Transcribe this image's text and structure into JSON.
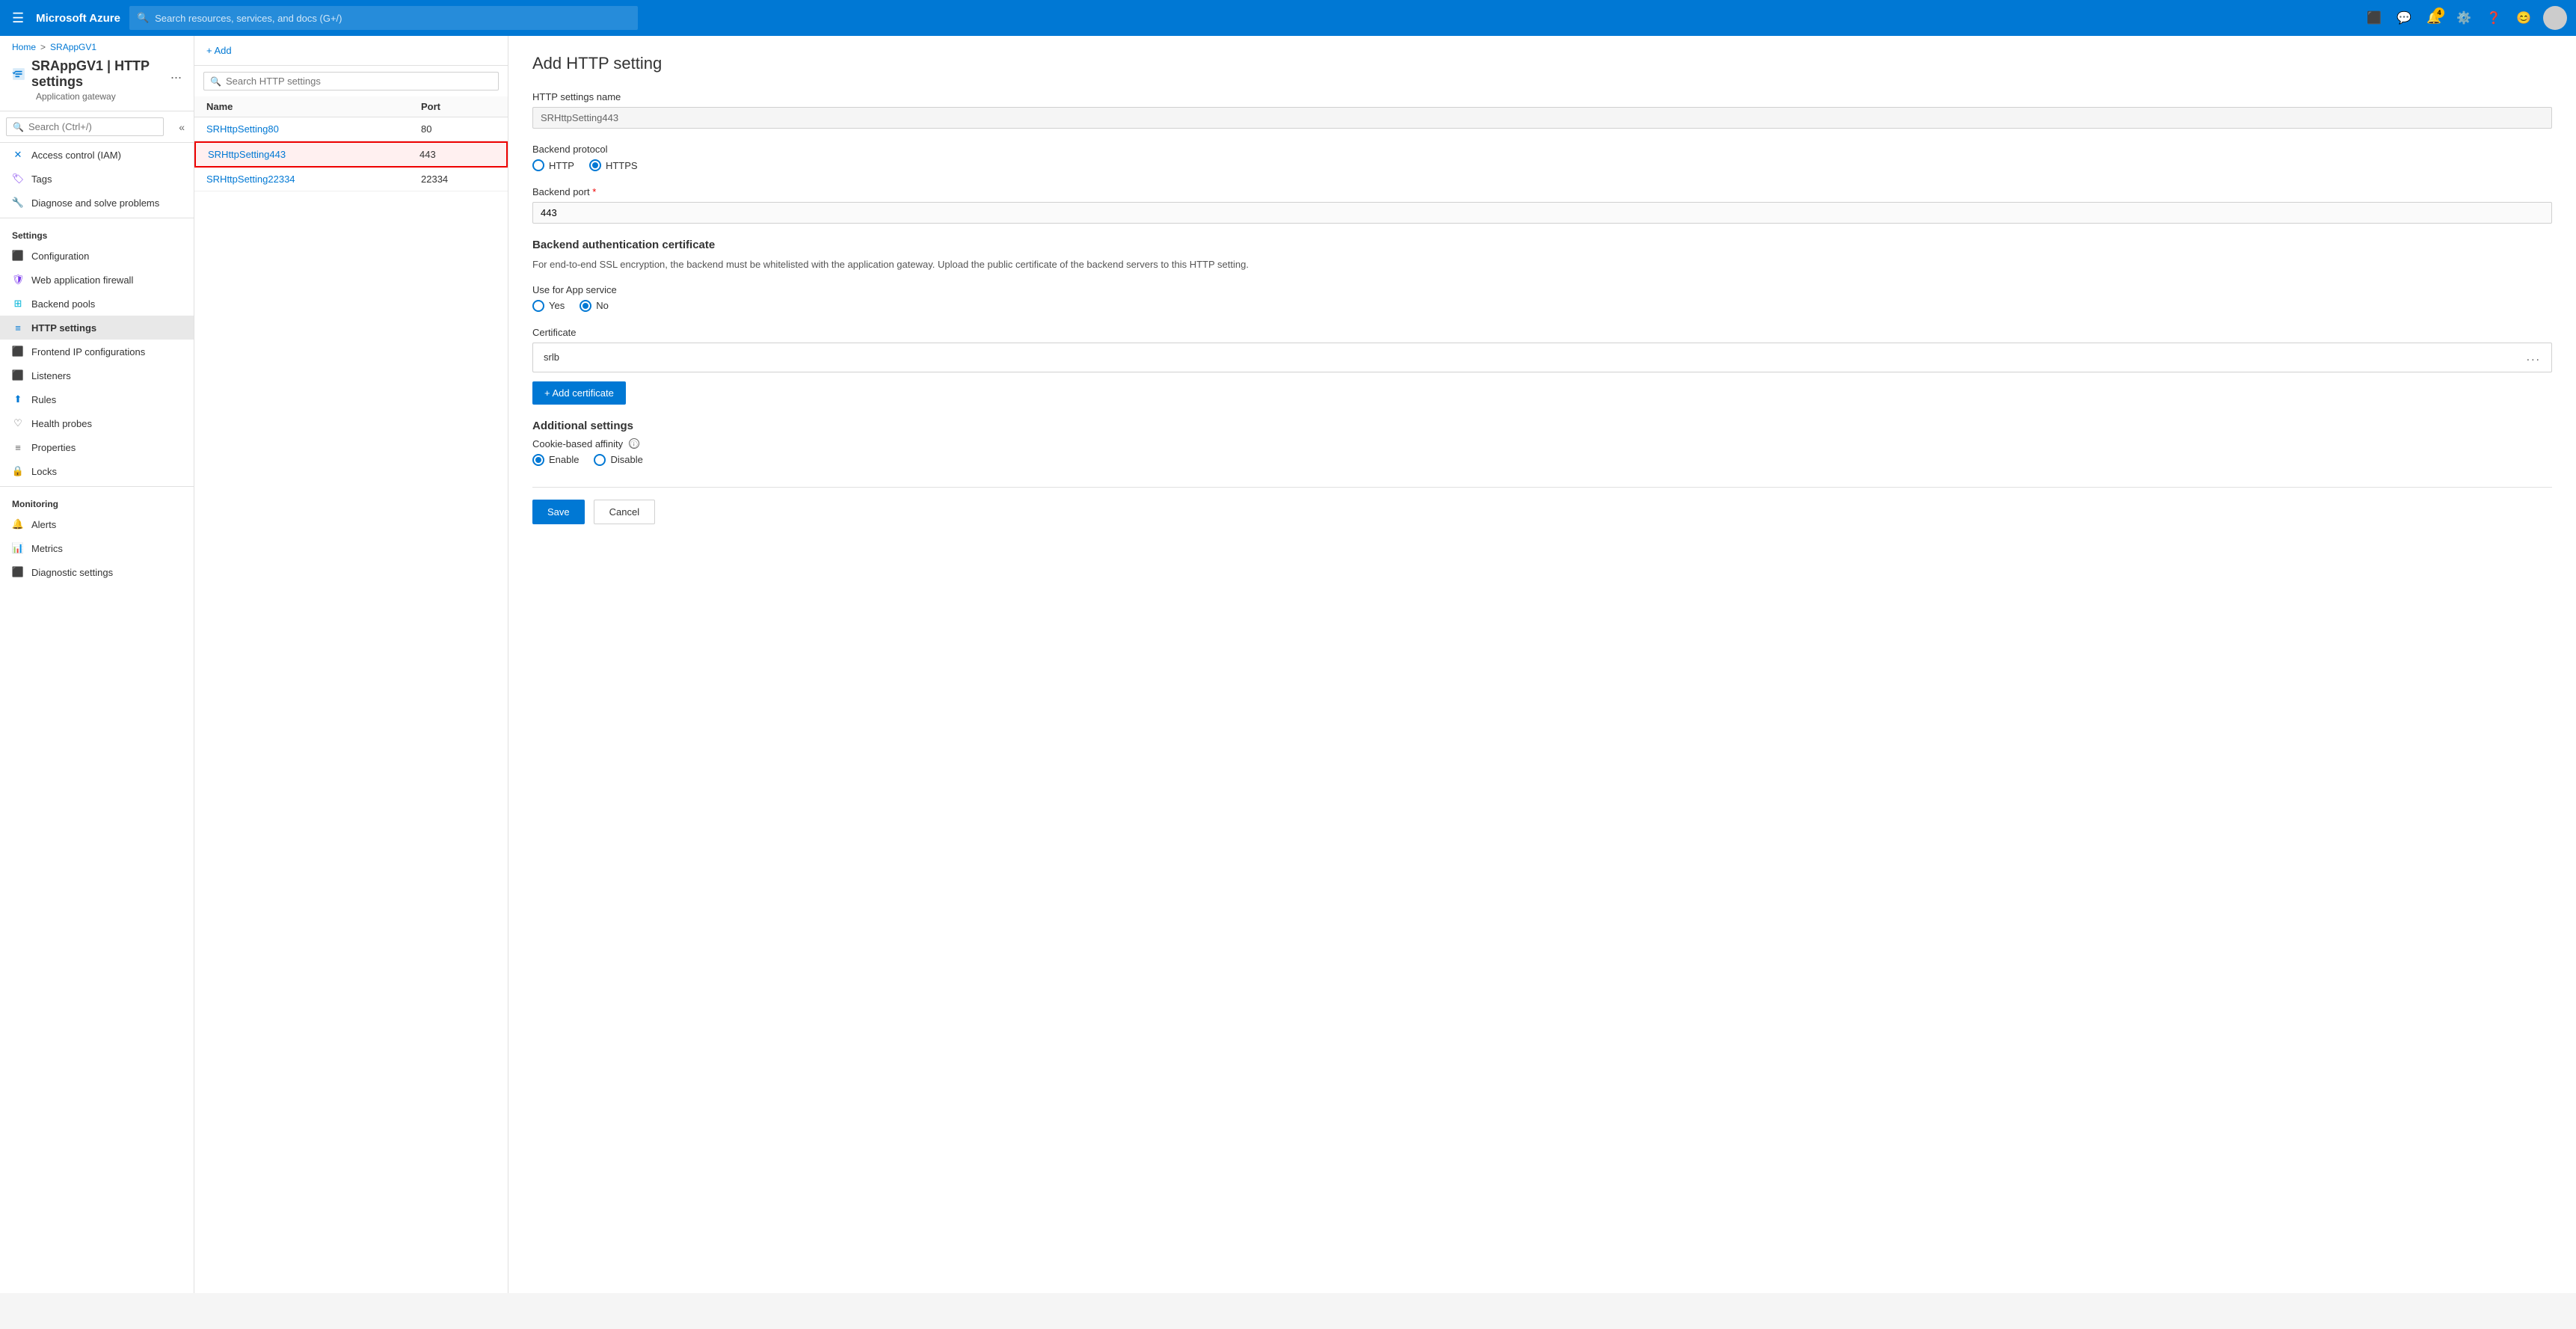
{
  "topbar": {
    "hamburger": "☰",
    "logo": "Microsoft Azure",
    "search_placeholder": "Search resources, services, and docs (G+/)",
    "notification_count": "4",
    "icons": [
      "terminal-icon",
      "feedback-icon",
      "notification-icon",
      "settings-icon",
      "help-icon",
      "smiley-icon"
    ]
  },
  "breadcrumb": {
    "home": "Home",
    "sep": ">",
    "resource": "SRAppGV1"
  },
  "resource": {
    "title": "SRAppGV1 | HTTP settings",
    "more": "...",
    "subtitle": "Application gateway"
  },
  "sidebar_search": {
    "placeholder": "Search (Ctrl+/)"
  },
  "nav": {
    "access_control": "Access control (IAM)",
    "tags": "Tags",
    "diagnose": "Diagnose and solve problems",
    "settings_label": "Settings",
    "configuration": "Configuration",
    "web_application_firewall": "Web application firewall",
    "backend_pools": "Backend pools",
    "http_settings": "HTTP settings",
    "frontend_ip": "Frontend IP configurations",
    "listeners": "Listeners",
    "rules": "Rules",
    "health_probes": "Health probes",
    "properties": "Properties",
    "locks": "Locks",
    "monitoring_label": "Monitoring",
    "alerts": "Alerts",
    "metrics": "Metrics",
    "diagnostic_settings": "Diagnostic settings"
  },
  "list_panel": {
    "add_label": "+ Add",
    "search_placeholder": "Search HTTP settings",
    "col_name": "Name",
    "col_port": "Port",
    "rows": [
      {
        "name": "SRHttpSetting80",
        "port": "80",
        "selected": false
      },
      {
        "name": "SRHttpSetting443",
        "port": "443",
        "selected": true
      },
      {
        "name": "SRHttpSetting22334",
        "port": "22334",
        "selected": false
      }
    ]
  },
  "detail": {
    "title": "Add HTTP setting",
    "http_settings_name_label": "HTTP settings name",
    "http_settings_name_value": "SRHttpSetting443",
    "backend_protocol_label": "Backend protocol",
    "protocol_http": "HTTP",
    "protocol_https": "HTTPS",
    "backend_port_label": "Backend port",
    "backend_port_required": "*",
    "backend_port_value": "443",
    "auth_cert_title": "Backend authentication certificate",
    "auth_cert_desc": "For end-to-end SSL encryption, the backend must be whitelisted with the application gateway. Upload the public certificate of the backend servers to this HTTP setting.",
    "use_app_service_label": "Use for App service",
    "yes_label": "Yes",
    "no_label": "No",
    "certificate_section": "Certificate",
    "cert_name": "srlb",
    "cert_more": "...",
    "add_cert_label": "+ Add certificate",
    "additional_settings_title": "Additional settings",
    "cookie_affinity_label": "Cookie-based affinity",
    "enable_label": "Enable",
    "disable_label": "Disable",
    "save_label": "Save",
    "cancel_label": "Cancel"
  }
}
